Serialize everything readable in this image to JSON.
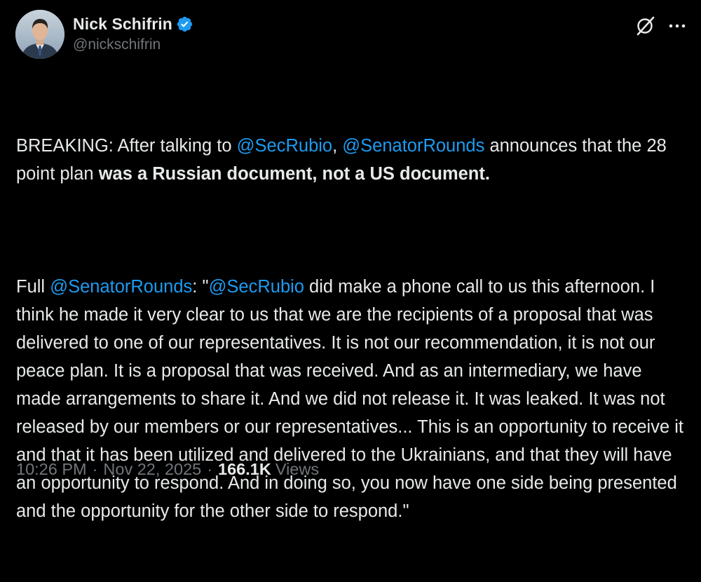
{
  "author": {
    "display_name": "Nick Schifrin",
    "handle": "@nickschifrin",
    "verified": true
  },
  "icons": {
    "verified": "verified-badge-icon",
    "grok": "grok-icon",
    "more": "more-options-icon"
  },
  "colors": {
    "background": "#000000",
    "text": "#e7e9ea",
    "secondary_text": "#71767b",
    "link": "#1d9bf0",
    "verified_badge": "#1d9bf0"
  },
  "tweet": {
    "p1": {
      "t1": "BREAKING: After talking to ",
      "m1": "@SecRubio",
      "t2": ", ",
      "m2": "@SenatorRounds",
      "t3": " announces that the 28 point plan ",
      "b1": "was a Russian document, not a US document."
    },
    "p2": {
      "t1": "Full ",
      "m1": "@SenatorRounds",
      "t2": ": \"",
      "m2": "@SecRubio",
      "t3": " did make a phone call to us this afternoon. I think he made it very clear to us that we are the recipients of a proposal that was delivered to one of our representatives. It is not our recommendation, it is not our peace plan. It is a proposal that was received. And as an intermediary, we have made arrangements to share it. And we did not release it. It was leaked. It was not released by our members or our representatives... This is an opportunity to receive it and that it has been utilized and delivered to the Ukrainians, and that they will have an opportunity to respond. And in doing so, you now have one side being presented and the opportunity for the other side to respond.\""
    }
  },
  "meta": {
    "time": "10:26 PM",
    "separator": "·",
    "date": "Nov 22, 2025",
    "views_count": "166.1K",
    "views_label": "Views"
  }
}
